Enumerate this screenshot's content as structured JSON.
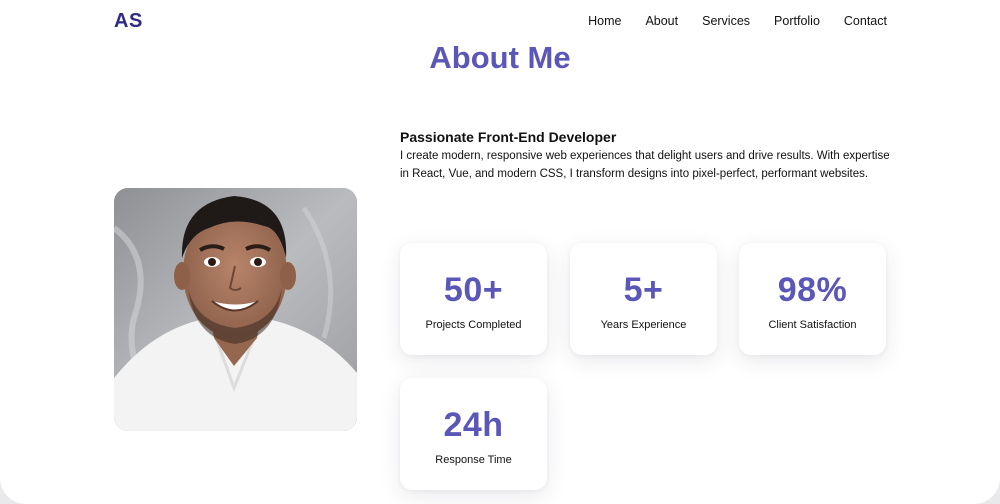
{
  "header": {
    "logo": "AS",
    "nav": [
      "Home",
      "About",
      "Services",
      "Portfolio",
      "Contact"
    ]
  },
  "section": {
    "title": "About Me",
    "heading": "Passionate Front-End Developer",
    "description": "I create modern, responsive web experiences that delight users and drive results. With expertise in React, Vue, and modern CSS, I transform designs into pixel-perfect, performant websites."
  },
  "stats": [
    {
      "value": "50+",
      "label": "Projects Completed"
    },
    {
      "value": "5+",
      "label": "Years Experience"
    },
    {
      "value": "98%",
      "label": "Client Satisfaction"
    },
    {
      "value": "24h",
      "label": "Response Time"
    }
  ],
  "colors": {
    "accent": "#5b57b8",
    "logo": "#2f2a86"
  }
}
